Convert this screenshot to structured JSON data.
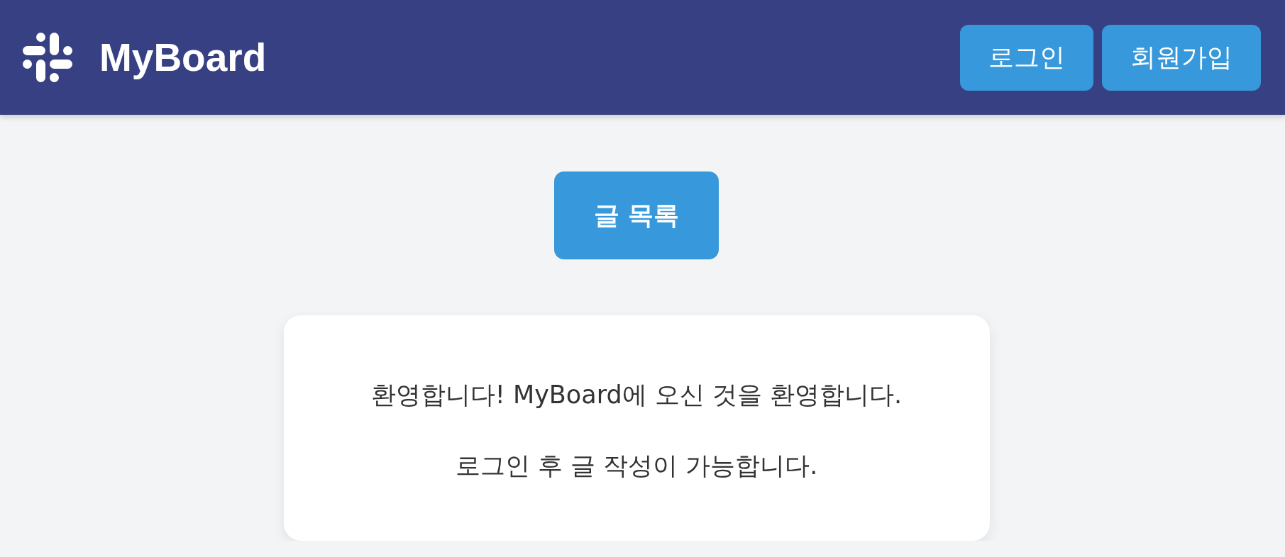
{
  "header": {
    "title": "MyBoard",
    "buttons": [
      {
        "label": "로그인"
      },
      {
        "label": "회원가입"
      }
    ]
  },
  "main": {
    "list_button": "글 목록",
    "welcome_card": {
      "lines": [
        "환영합니다! MyBoard에 오신 것을 환영합니다.",
        "로그인 후 글 작성이 가능합니다."
      ]
    }
  }
}
